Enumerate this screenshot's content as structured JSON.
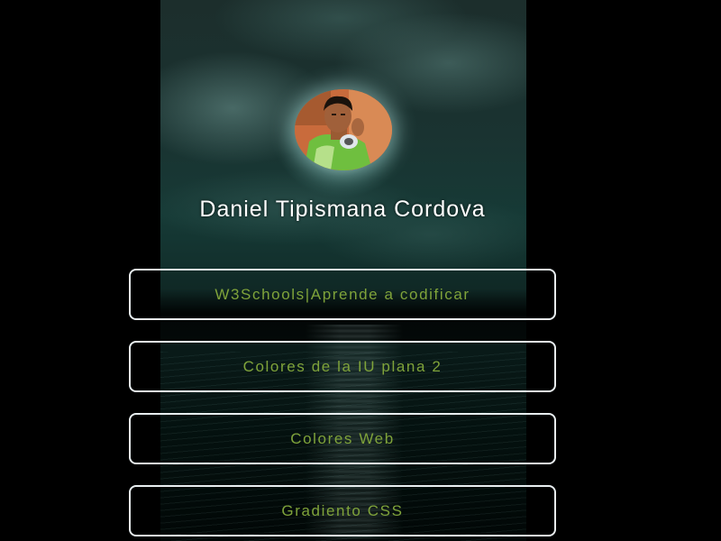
{
  "profile": {
    "name": "Daniel Tipismana Cordova",
    "avatar_icon": "profile-photo"
  },
  "links": [
    {
      "label": "W3Schools|Aprende a codificar"
    },
    {
      "label": "Colores de la IU plana 2"
    },
    {
      "label": "Colores Web"
    },
    {
      "label": "Gradiento CSS"
    }
  ],
  "colors": {
    "background": "#000000",
    "link_text": "#7fa33a",
    "link_border": "#e8eef0",
    "name_text": "#ffffff"
  }
}
